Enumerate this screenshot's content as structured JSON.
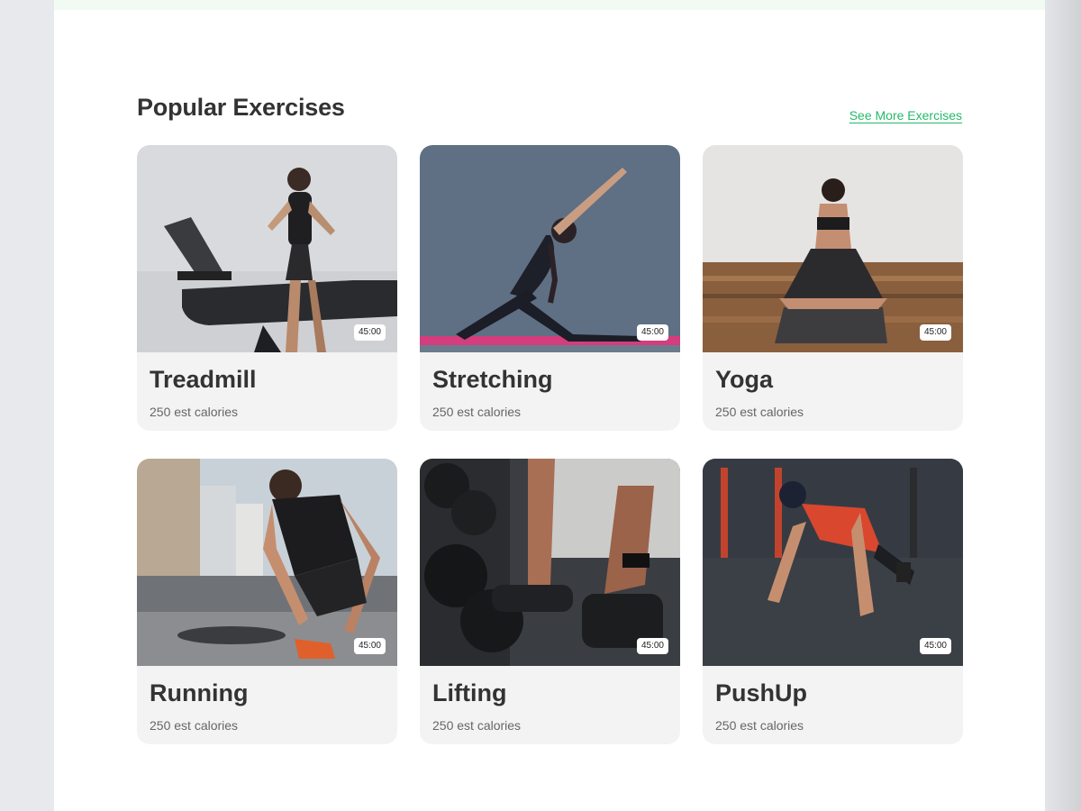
{
  "section": {
    "title": "Popular Exercises",
    "see_more_label": "See More Exercises"
  },
  "exercises": [
    {
      "name": "Treadmill",
      "calories": "250 est calories",
      "duration": "45:00",
      "image_icon": "treadmill-photo"
    },
    {
      "name": "Stretching",
      "calories": "250 est calories",
      "duration": "45:00",
      "image_icon": "stretching-photo"
    },
    {
      "name": "Yoga",
      "calories": "250 est calories",
      "duration": "45:00",
      "image_icon": "yoga-photo"
    },
    {
      "name": "Running",
      "calories": "250 est calories",
      "duration": "45:00",
      "image_icon": "running-photo"
    },
    {
      "name": "Lifting",
      "calories": "250 est calories",
      "duration": "45:00",
      "image_icon": "lifting-photo"
    },
    {
      "name": "PushUp",
      "calories": "250 est calories",
      "duration": "45:00",
      "image_icon": "pushup-photo"
    }
  ],
  "colors": {
    "accent": "#25b96a",
    "card_bg": "#f3f3f3",
    "title": "#333333"
  }
}
